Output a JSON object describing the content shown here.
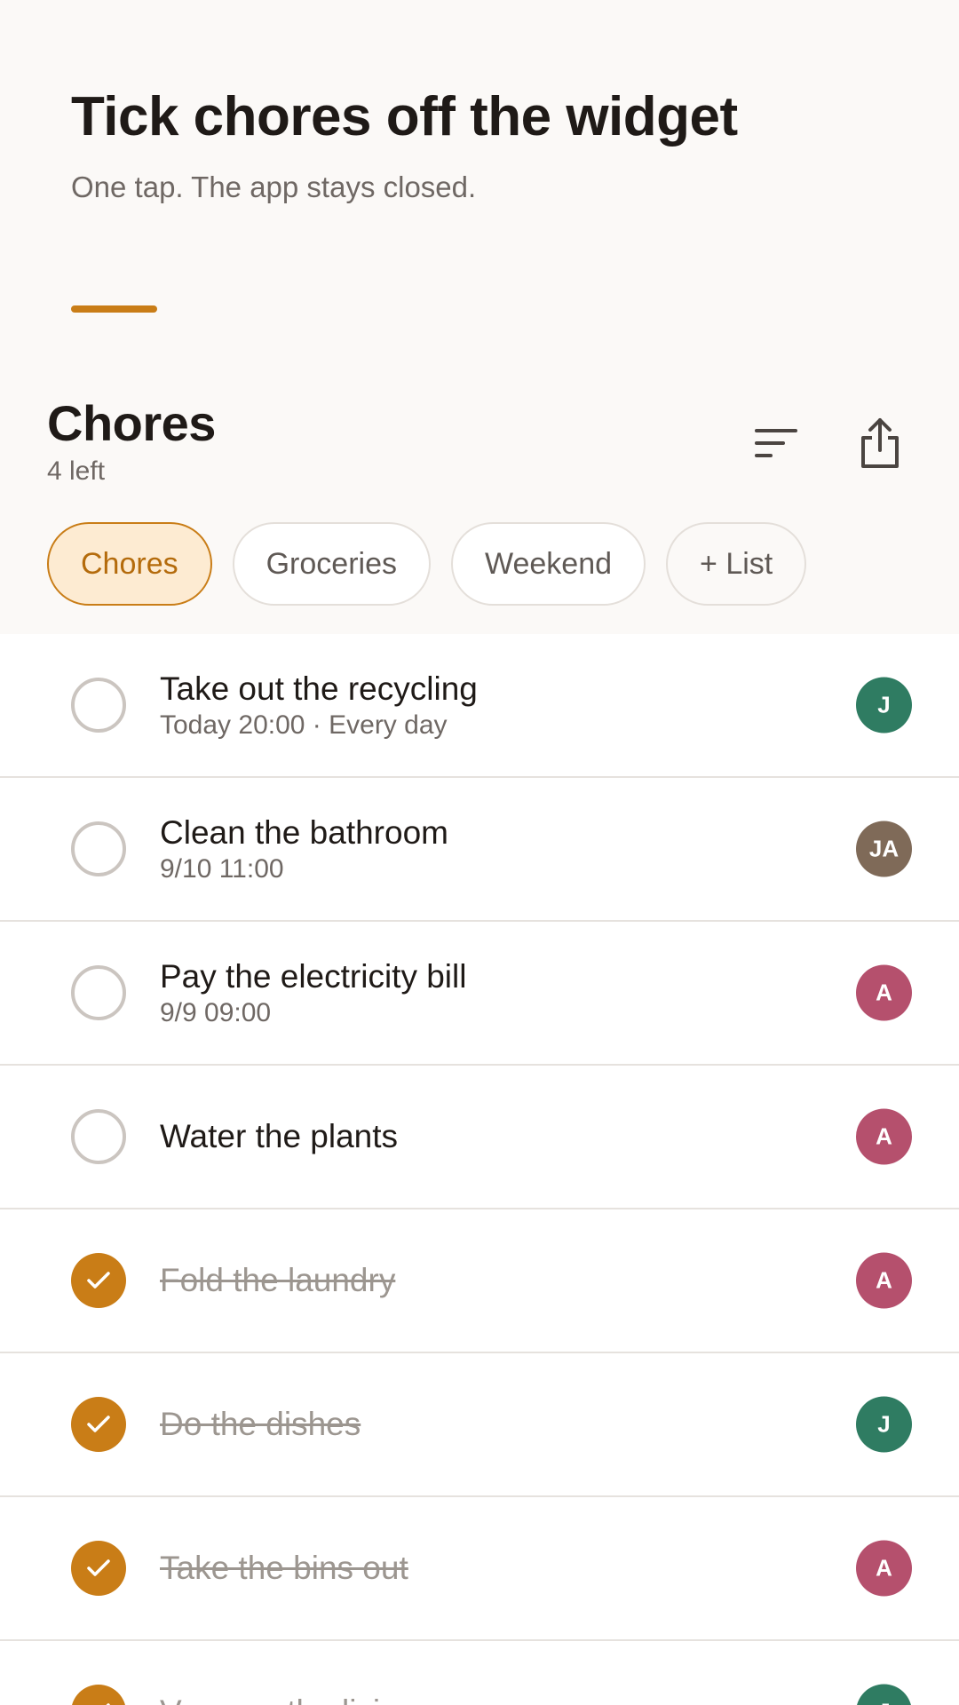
{
  "hero": {
    "title": "Tick chores off the widget",
    "subtitle": "One tap. The app stays closed."
  },
  "list": {
    "title": "Chores",
    "remaining": "4 left"
  },
  "actions": {
    "sort_icon": "sort-icon",
    "share_icon": "share-icon"
  },
  "chips": [
    {
      "label": "Chores",
      "active": true
    },
    {
      "label": "Groceries",
      "active": false
    },
    {
      "label": "Weekend",
      "active": false
    },
    {
      "label": "+ List",
      "active": false
    }
  ],
  "colors": {
    "accent": "#c97d17",
    "chip_active_bg": "#fdebd2",
    "avatar_j": "#2f7c62",
    "avatar_ja": "#7f6a58",
    "avatar_a": "#b5506d"
  },
  "tasks": [
    {
      "title": "Take out the recycling",
      "meta": "Today 20:00 · Every day",
      "done": false,
      "assignee": "J",
      "assignee_color": "#2f7c62"
    },
    {
      "title": "Clean the bathroom",
      "meta": "9/10 11:00",
      "done": false,
      "assignee": "JA",
      "assignee_color": "#7f6a58"
    },
    {
      "title": "Pay the electricity bill",
      "meta": "9/9 09:00",
      "done": false,
      "assignee": "A",
      "assignee_color": "#b5506d"
    },
    {
      "title": "Water the plants",
      "meta": "",
      "done": false,
      "assignee": "A",
      "assignee_color": "#b5506d"
    },
    {
      "title": "Fold the laundry",
      "meta": "",
      "done": true,
      "assignee": "A",
      "assignee_color": "#b5506d"
    },
    {
      "title": "Do the dishes",
      "meta": "",
      "done": true,
      "assignee": "J",
      "assignee_color": "#2f7c62"
    },
    {
      "title": "Take the bins out",
      "meta": "",
      "done": true,
      "assignee": "A",
      "assignee_color": "#b5506d"
    },
    {
      "title": "Vacuum the living room",
      "meta": "",
      "done": true,
      "assignee": "J",
      "assignee_color": "#2f7c62"
    }
  ]
}
